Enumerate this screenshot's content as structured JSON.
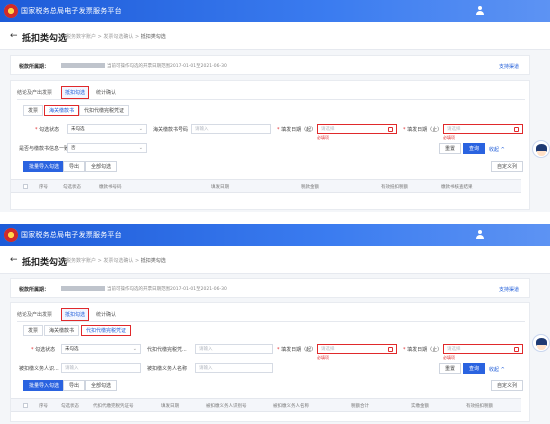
{
  "screens": [
    {
      "header_title": "国家税务总局电子发票服务平台",
      "back_label": "←",
      "page_title": "抵扣类勾选",
      "breadcrumb": [
        "税务数字账户",
        "发票勾选确认",
        "抵扣类勾选"
      ],
      "period_label": "税款所属期：",
      "period_info": "当前可操作勾选的开票日期范围2017-01-01至2021-06-30",
      "support_link": "支持渠道",
      "tabs": [
        "抵扣勾选",
        "统计确认"
      ],
      "tab_prefix": "结论及产出发票",
      "sub_tabs": [
        "发票",
        "海关缴款书",
        "代扣代缴完税凭证"
      ],
      "form": {
        "status_label": "勾选状态",
        "status_value": "未勾选",
        "doc_label": "海关缴款书号码",
        "doc_placeholder": "请输入",
        "start_label": "填发日期（起）",
        "start_placeholder": "请选择",
        "end_label": "填发日期（止）",
        "end_placeholder": "请选择",
        "required_error": "必填项",
        "consistent_label": "是否与缴款书信息一致",
        "consistent_value": "否"
      },
      "buttons": {
        "reset": "重置",
        "query": "查询",
        "collapse": "收起 ^",
        "batch": "批量导入勾选",
        "export": "导出",
        "all": "全部勾选",
        "columns": "自定义列"
      },
      "columns": [
        "序号",
        "勾选状态",
        "缴款书号码",
        "填发日期",
        "税款金额",
        "有效抵扣税额",
        "缴款书核查结果"
      ]
    },
    {
      "header_title": "国家税务总局电子发票服务平台",
      "back_label": "←",
      "page_title": "抵扣类勾选",
      "breadcrumb": [
        "税务数字账户",
        "发票勾选确认",
        "抵扣类勾选"
      ],
      "period_label": "税款所属期：",
      "period_info": "当前可操作勾选的开票日期范围2017-01-01至2021-06-30",
      "support_link": "支持渠道",
      "tabs": [
        "抵扣勾选",
        "统计确认"
      ],
      "tab_prefix": "结论及产出发票",
      "sub_tabs": [
        "发票",
        "海关缴款书",
        "代扣代缴完税凭证"
      ],
      "form": {
        "status_label": "勾选状态",
        "status_value": "未勾选",
        "doc_label": "代扣代缴完税凭...",
        "doc_placeholder": "请输入",
        "start_label": "填发日期（起）",
        "start_placeholder": "请选择",
        "end_label": "填发日期（止）",
        "end_placeholder": "请选择",
        "required_error": "必填项",
        "agent_label": "被扣缴义务人识...",
        "agent_placeholder": "请输入",
        "agent_name_label": "被扣缴义务人名称",
        "agent_name_placeholder": "请输入"
      },
      "buttons": {
        "reset": "重置",
        "query": "查询",
        "collapse": "收起 ^",
        "batch": "批量导入勾选",
        "export": "导出",
        "all": "全部勾选",
        "columns": "自定义列"
      },
      "columns": [
        "序号",
        "勾选状态",
        "代扣代缴完税凭证号",
        "填发日期",
        "被扣缴义务人识别号",
        "被扣缴义务人名称",
        "税额合计",
        "实缴金额",
        "有效抵扣税额"
      ]
    }
  ]
}
